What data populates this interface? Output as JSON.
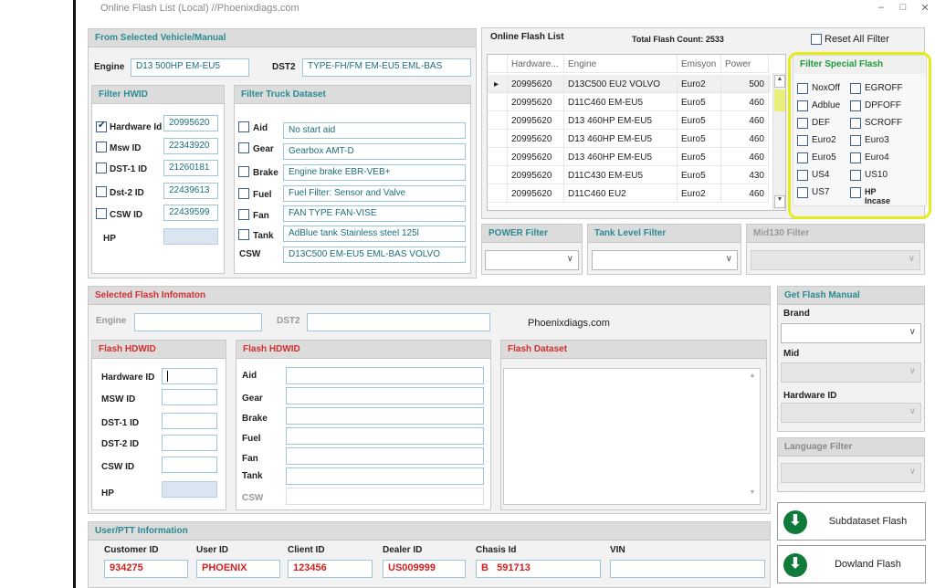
{
  "window": {
    "title": "Online Flash List (Local) //Phoenixdiags.com",
    "min": "–",
    "restore": "□",
    "close": "✕"
  },
  "vehicle": {
    "header": "From Selected Vehicle/Manual",
    "engine_label": "Engine",
    "engine_value": "D13 500HP EM-EU5",
    "dst2_label": "DST2",
    "dst2_value": "TYPE-FH/FM EM-EU5 EML-BAS"
  },
  "filter_hwid": {
    "header": "Filter HWID",
    "rows": [
      {
        "label": "Hardware Id",
        "value": "20995620",
        "checked": true
      },
      {
        "label": "Msw ID",
        "value": "22343920",
        "checked": false
      },
      {
        "label": "DST-1 ID",
        "value": "21260181",
        "checked": false
      },
      {
        "label": "Dst-2 ID",
        "value": "22439613",
        "checked": false
      },
      {
        "label": "CSW ID",
        "value": "22439599",
        "checked": false
      }
    ],
    "hp_label": "HP"
  },
  "filter_truck": {
    "header": "Filter Truck Dataset",
    "rows": [
      {
        "label": "Aid",
        "value": "No start aid"
      },
      {
        "label": "Gear",
        "value": "Gearbox AMT-D"
      },
      {
        "label": "Brake",
        "value": "Engine brake EBR-VEB+"
      },
      {
        "label": "Fuel",
        "value": "Fuel Filter: Sensor and Valve"
      },
      {
        "label": "Fan",
        "value": "FAN TYPE FAN-VISE"
      },
      {
        "label": "Tank",
        "value": "AdBlue tank Stainless steel 125l"
      }
    ],
    "csw_label": "CSW",
    "csw_value": "D13C500 EM-EU5 EML-BAS VOLVO"
  },
  "online_list": {
    "header": "Online Flash  List",
    "count_label": "Total Flash Count: 2533",
    "columns": [
      "Hardware...",
      "Engine",
      "Emisyon",
      "Power"
    ],
    "rows": [
      [
        "20995620",
        "D13C500 EU2 VOLVO",
        "Euro2",
        "500"
      ],
      [
        "20995620",
        "D11C460 EM-EU5",
        "Euro5",
        "460"
      ],
      [
        "20995620",
        "D13 460HP EM-EU5",
        "Euro5",
        "460"
      ],
      [
        "20995620",
        "D13 460HP EM-EU5",
        "Euro5",
        "460"
      ],
      [
        "20995620",
        "D13 460HP EM-EU5",
        "Euro5",
        "460"
      ],
      [
        "20995620",
        "D11C430 EM-EU5",
        "Euro5",
        "430"
      ],
      [
        "20995620",
        "D11C460 EU2",
        "Euro2",
        "460"
      ]
    ],
    "row_pointer": "▸"
  },
  "reset_all": {
    "label": "Reset All Filter"
  },
  "special_filter": {
    "header": "Filter Special Flash",
    "left": [
      "NoxOff",
      "Adblue",
      "DEF",
      "Euro2",
      "Euro5",
      "US4",
      "US7"
    ],
    "right": [
      "EGROFF",
      "DPFOFF",
      "SCROFF",
      "Euro3",
      "Euro4",
      "US10",
      "HP Incase"
    ]
  },
  "filters": {
    "power": "POWER Filter",
    "tank": "Tank Level Filter",
    "mid130": "Mid130 Filter"
  },
  "selected_info": {
    "header": "Selected Flash Infomaton",
    "engine_label": "Engine",
    "dst2_label": "DST2",
    "site": "Phoenixdiags.com"
  },
  "flash_hdwid_1": {
    "header": "Flash HDWID",
    "labels": [
      "Hardware ID",
      "MSW ID",
      "DST-1 ID",
      "DST-2 ID",
      "CSW ID",
      "HP"
    ]
  },
  "flash_hdwid_2": {
    "header": "Flash HDWID",
    "labels": [
      "Aid",
      "Gear",
      "Brake",
      "Fuel",
      "Fan",
      "Tank",
      "CSW"
    ]
  },
  "flash_dataset": {
    "header": "Flash Dataset"
  },
  "get_manual": {
    "header": "Get Flash Manual",
    "brand": "Brand",
    "mid": "Mid",
    "hardware": "Hardware ID",
    "language": "Language Filter"
  },
  "user": {
    "header": "User/PTT Information",
    "fields": [
      {
        "label": "Customer ID",
        "value": "934275"
      },
      {
        "label": "User ID",
        "value": "PHOENIX"
      },
      {
        "label": "Client ID",
        "value": "123456"
      },
      {
        "label": "Dealer ID",
        "value": "US009999"
      },
      {
        "label": "Chasis Id",
        "value": "B   591713"
      },
      {
        "label": "VIN",
        "value": ""
      }
    ]
  },
  "buttons": {
    "subdataset": "Subdataset Flash",
    "download": "Dowland Flash",
    "icon": "⬇"
  },
  "colors": {
    "teal": "#2a8a92",
    "red": "#d32f2f",
    "highlight": "#e6ec1c",
    "green": "#0f7a3a"
  }
}
